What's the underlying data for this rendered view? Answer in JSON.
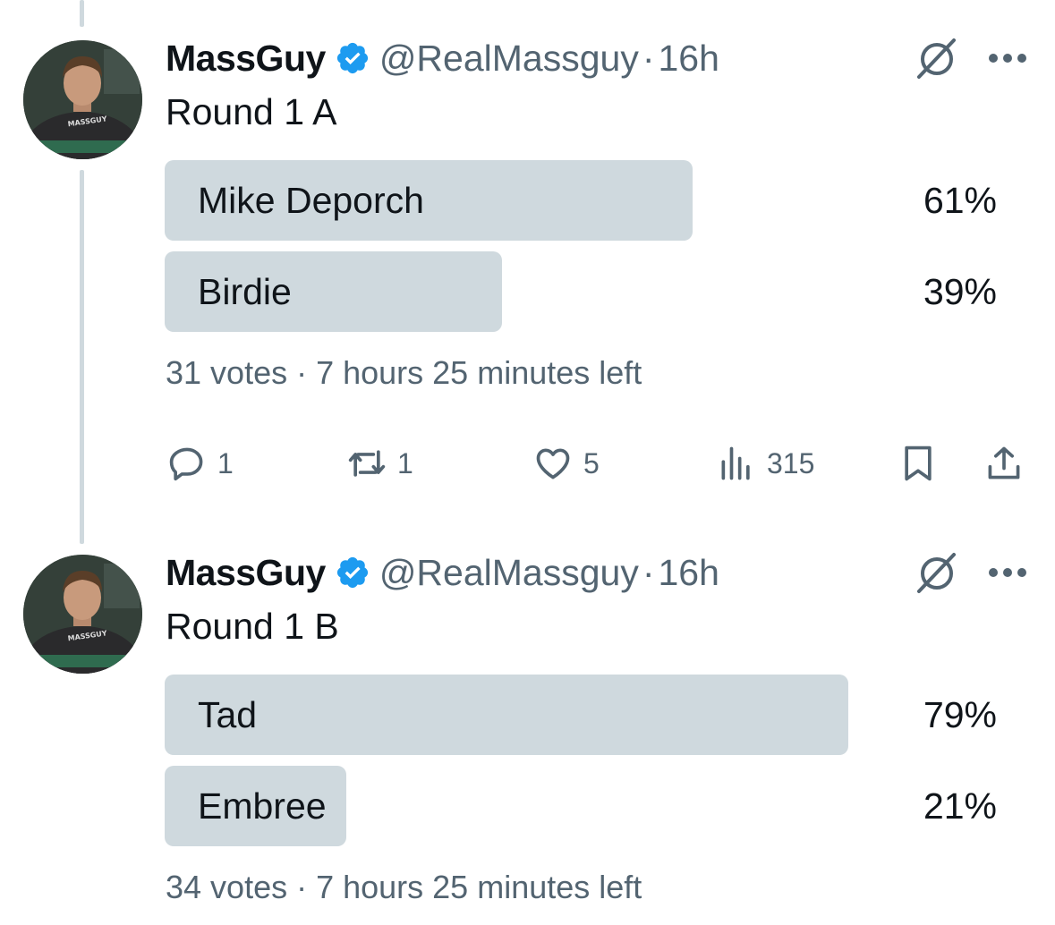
{
  "tweets": [
    {
      "author_name": "MassGuy",
      "handle": "@RealMassguy",
      "separator": "·",
      "time": "16h",
      "text": "Round 1 A",
      "poll": {
        "options": [
          {
            "label": "Mike Deporch",
            "percent_text": "61%",
            "fraction": 0.61
          },
          {
            "label": "Birdie",
            "percent_text": "39%",
            "fraction": 0.39
          }
        ],
        "meta": "31 votes · 7 hours 25 minutes left"
      },
      "actions": {
        "replies": "1",
        "reposts": "1",
        "likes": "5",
        "views": "315"
      }
    },
    {
      "author_name": "MassGuy",
      "handle": "@RealMassguy",
      "separator": "·",
      "time": "16h",
      "text": "Round 1 B",
      "poll": {
        "options": [
          {
            "label": "Tad",
            "percent_text": "79%",
            "fraction": 0.79
          },
          {
            "label": "Embree",
            "percent_text": "21%",
            "fraction": 0.21
          }
        ],
        "meta": "34 votes · 7 hours 25 minutes left"
      }
    }
  ],
  "avatar_shirt_text": "MASSGUY",
  "colors": {
    "text": "#0f1419",
    "secondary": "#536471",
    "poll_bar": "#cfd9de",
    "verified": "#1d9bf0",
    "thread_line": "#cfd9de"
  },
  "icons": [
    "verified-badge-icon",
    "grok-icon",
    "more-icon",
    "reply-icon",
    "repost-icon",
    "like-icon",
    "views-icon",
    "bookmark-icon",
    "share-icon"
  ]
}
